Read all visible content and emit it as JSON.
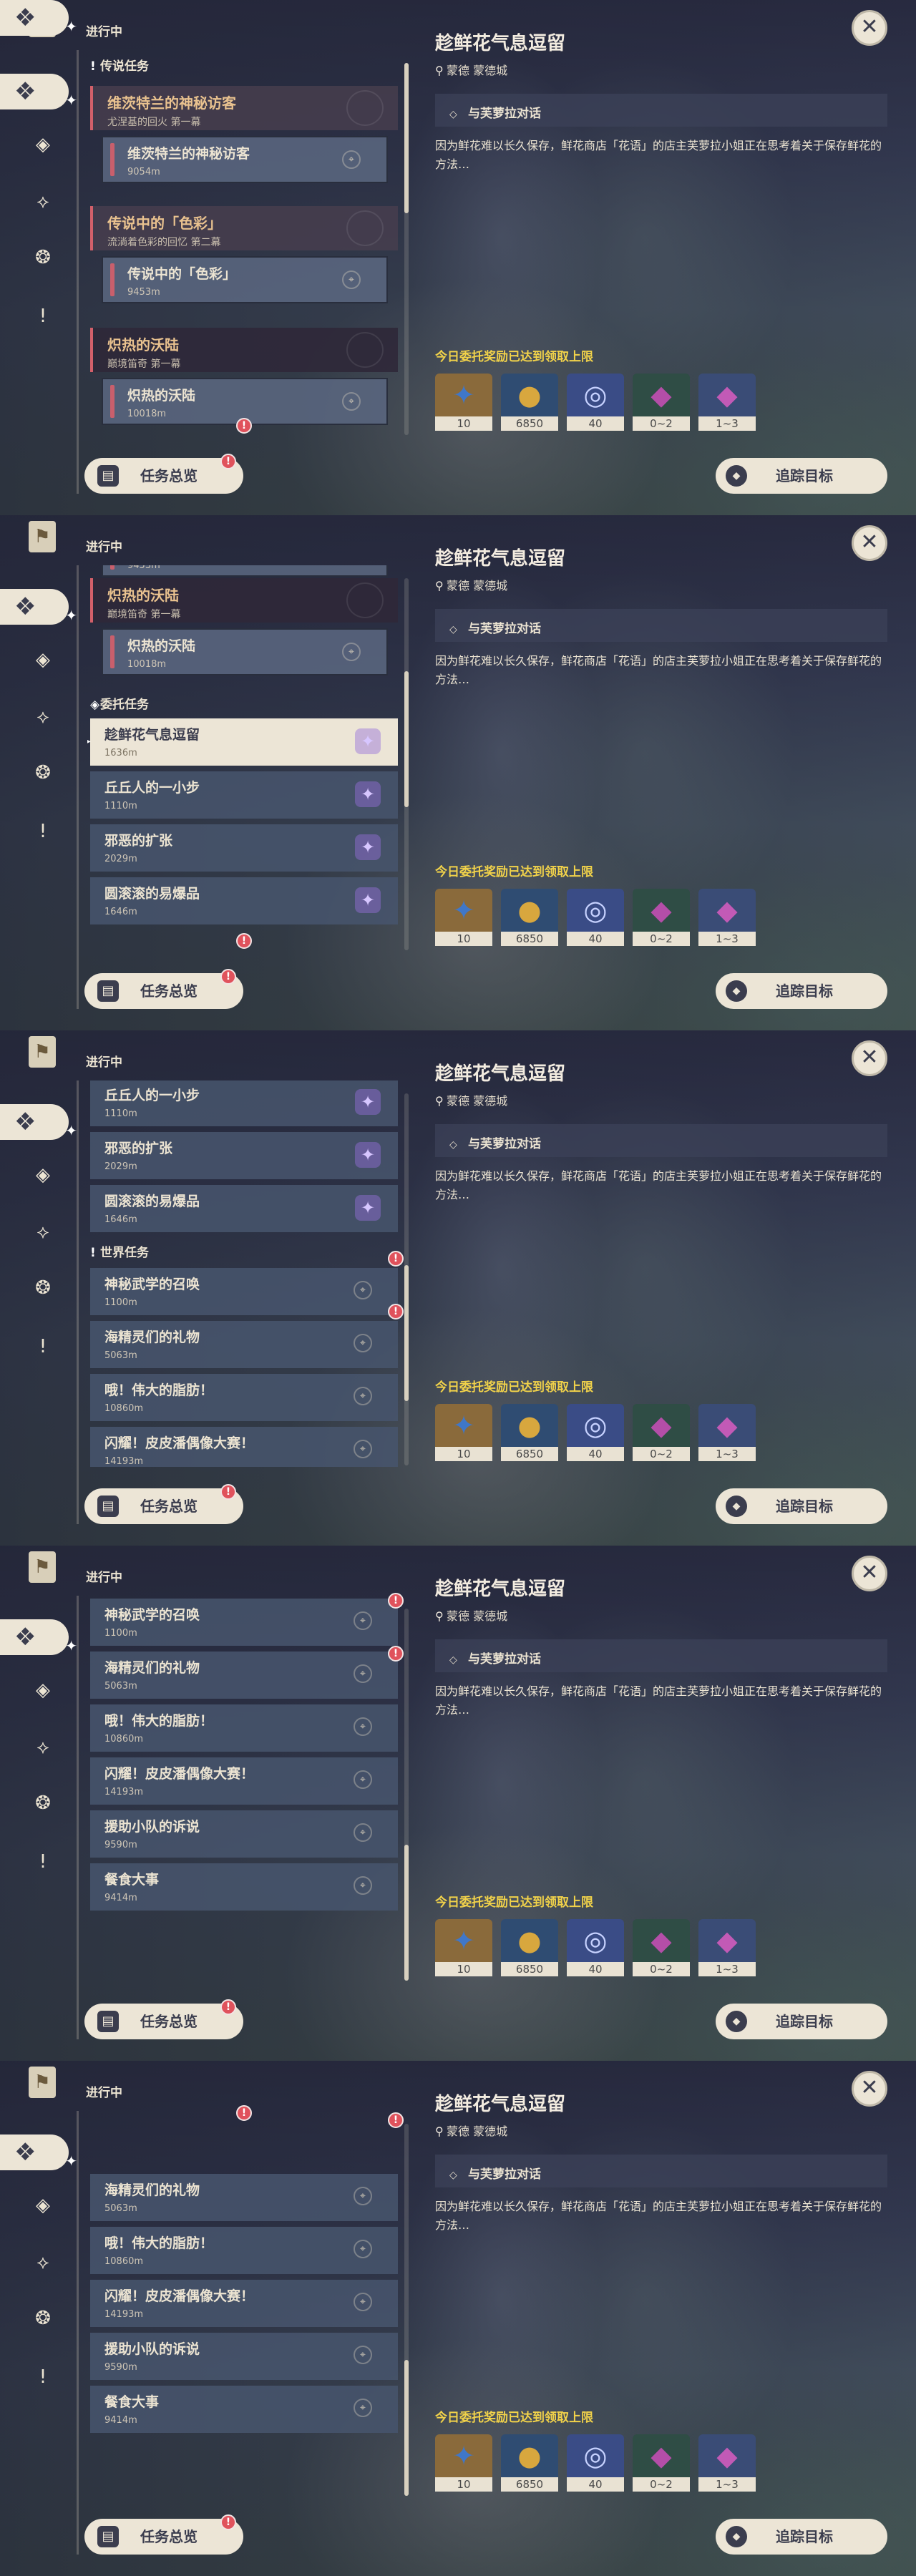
{
  "header": "进行中",
  "close": "✕",
  "legend_section": {
    "label": "传说任务",
    "quests": [
      {
        "title": "维茨特兰的神秘访客",
        "subtitle": "尤涅基的回火 第一幕",
        "step": "维茨特兰的神秘访客",
        "distance": "9054m"
      },
      {
        "title": "传说中的「色彩」",
        "subtitle": "流淌着色彩的回忆 第二幕",
        "step": "传说中的「色彩」",
        "distance": "9453m"
      },
      {
        "title": "炽热的沃陆",
        "subtitle": "巅境笛奇 第一幕",
        "step": "炽热的沃陆",
        "distance": "10018m"
      }
    ],
    "partial_distance": "9453m"
  },
  "commission_section": {
    "label": "委托任务",
    "items": [
      {
        "title": "趁鲜花气息逗留",
        "distance": "1636m"
      },
      {
        "title": "丘丘人的一小步",
        "distance": "1110m"
      },
      {
        "title": "邪恶的扩张",
        "distance": "2029m"
      },
      {
        "title": "圆滚滚的易爆品",
        "distance": "1646m"
      }
    ]
  },
  "world_section": {
    "label": "世界任务",
    "items": [
      {
        "title": "神秘武学的召唤",
        "distance": "1100m"
      },
      {
        "title": "海精灵们的礼物",
        "distance": "5063m"
      },
      {
        "title": "哦！伟大的脂肪！",
        "distance": "10860m"
      },
      {
        "title": "闪耀！皮皮潘偶像大赛！",
        "distance": "14193m"
      },
      {
        "title": "援助小队的诉说",
        "distance": "9590m"
      },
      {
        "title": "餐食大事",
        "distance": "9414m"
      }
    ]
  },
  "alert_glyph": "!",
  "detail": {
    "title": "趁鲜花气息逗留",
    "location": "蒙德 蒙德城",
    "objective": "与芙萝拉对话",
    "description": "因为鲜花难以长久保存，鲜花商店「花语」的店主芙萝拉小姐正在思考着关于保存鲜花的方法…",
    "limit_notice": "今日委托奖励已达到领取上限"
  },
  "rewards": [
    {
      "icon": "adventure-exp-icon",
      "count": "10",
      "color": "#3f77c9",
      "bg": "#8a6a3b",
      "glyph": "✦"
    },
    {
      "icon": "mora-icon",
      "count": "6850",
      "color": "#d8a73e",
      "bg": "#2f4c72",
      "glyph": "●"
    },
    {
      "icon": "friendship-exp-icon",
      "count": "40",
      "color": "#c7d2ff",
      "bg": "#3a4c86",
      "glyph": "◎"
    },
    {
      "icon": "crystal-chunk-icon",
      "count": "0~2",
      "color": "#b44ea8",
      "bg": "#2f4d45",
      "glyph": "◆"
    },
    {
      "icon": "crystal-cluster-icon",
      "count": "1~3",
      "color": "#c25ab6",
      "bg": "#3a4c76",
      "glyph": "◆"
    }
  ],
  "buttons": {
    "overview": "任务总览",
    "track": "追踪目标"
  },
  "rail_icons": [
    "quest-book-icon",
    "commission-icon",
    "legend-icon",
    "world-icon",
    "archon-icon",
    "alert-icon"
  ]
}
